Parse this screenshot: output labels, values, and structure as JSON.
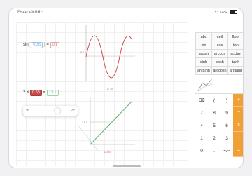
{
  "status": {
    "time": "下午1:12",
    "date": "4月6日周三",
    "battery": "100%"
  },
  "expr1": {
    "func": "sin(",
    "arg": "0.36",
    "close": ")",
    "eq": "=",
    "result": "0.1"
  },
  "expr2": {
    "coef": "2",
    "times": "×",
    "arg": "0.65",
    "eq": "=",
    "result": "13.1"
  },
  "graph1": {
    "y_tick": "0.1",
    "x_tick": "0.36"
  },
  "graph2": {
    "y_tick": "13.1",
    "x_tick": "0.65"
  },
  "slider": {
    "value_fraction": 0.7
  },
  "functions": [
    [
      "abs",
      "ceil",
      "floor"
    ],
    [
      "sin",
      "cos",
      "tan"
    ],
    [
      "arcsin",
      "arccos",
      "arctan"
    ],
    [
      "sinh",
      "cosh",
      "tanh"
    ],
    [
      "arcsinh",
      "arccosh",
      "arctanh"
    ]
  ],
  "keypad": {
    "row1": [
      "⌫",
      "(",
      ")",
      "+"
    ],
    "row2": [
      "7",
      "8",
      "9",
      "−"
    ],
    "row3": [
      "4",
      "5",
      "6",
      "×"
    ],
    "row4": [
      "1",
      "2",
      "3",
      "÷"
    ],
    "row5": [
      "0",
      ".",
      "+/−",
      "="
    ]
  },
  "colors": {
    "accent": "#f0a035",
    "sin_curve": "#c94b4b",
    "line": "#66b070"
  }
}
